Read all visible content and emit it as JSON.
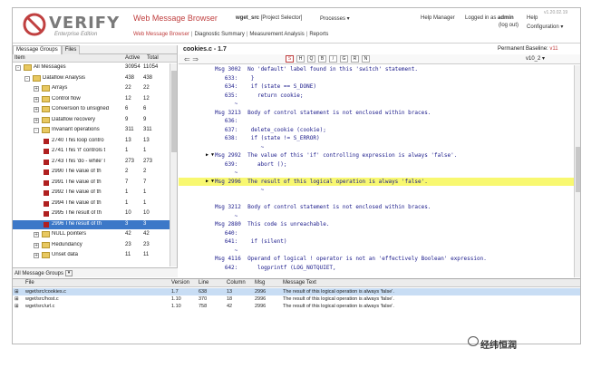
{
  "header": {
    "logo_text": "VERIFY",
    "logo_sub": "Enterprise Edition",
    "app_title": "Web Message Browser",
    "project": "wget_src",
    "project_selector": "[Project Selector]",
    "processes": "Processes ▾",
    "help_manager": "Help Manager",
    "logged_in_as": "Logged in as",
    "user": "admin",
    "logout": "(log out)",
    "help": "Help",
    "configuration": "Configuration ▾",
    "version": "v1.20.02.19",
    "nav_links": [
      "Web Message Browser",
      "Diagnostic Summary",
      "Measurement Analysis",
      "Reports"
    ]
  },
  "left_panel": {
    "tabs": [
      "Message Groups",
      "Files"
    ],
    "columns": [
      "Item",
      "Active",
      "Total"
    ],
    "rows": [
      {
        "label": "All Messages",
        "active": "30954",
        "total": "11054",
        "level": 0,
        "type": "folder",
        "exp": "-"
      },
      {
        "label": "Dataflow Analysis",
        "active": "438",
        "total": "438",
        "level": 1,
        "type": "folder",
        "exp": "-"
      },
      {
        "label": "Arrays",
        "active": "22",
        "total": "22",
        "level": 2,
        "type": "folder",
        "exp": "+"
      },
      {
        "label": "Control flow",
        "active": "12",
        "total": "12",
        "level": 2,
        "type": "folder",
        "exp": "+"
      },
      {
        "label": "Conversion to unsigned",
        "active": "6",
        "total": "6",
        "level": 2,
        "type": "folder",
        "exp": "+"
      },
      {
        "label": "Dataflow recovery",
        "active": "9",
        "total": "9",
        "level": 2,
        "type": "folder",
        "exp": "+"
      },
      {
        "label": "Invariant operations",
        "active": "311",
        "total": "311",
        "level": 2,
        "type": "folder",
        "exp": "-"
      },
      {
        "label": "2740 This loop contro",
        "active": "13",
        "total": "13",
        "level": 3,
        "type": "msg"
      },
      {
        "label": "2741 This 'if' controls t",
        "active": "1",
        "total": "1",
        "level": 3,
        "type": "msg"
      },
      {
        "label": "2743 This 'do - while' l",
        "active": "273",
        "total": "273",
        "level": 3,
        "type": "msg"
      },
      {
        "label": "2990 The value of th",
        "active": "2",
        "total": "2",
        "level": 3,
        "type": "msg"
      },
      {
        "label": "2991 The value of th",
        "active": "7",
        "total": "7",
        "level": 3,
        "type": "msg"
      },
      {
        "label": "2992 The value of th",
        "active": "1",
        "total": "1",
        "level": 3,
        "type": "msg"
      },
      {
        "label": "2994 The value of th",
        "active": "1",
        "total": "1",
        "level": 3,
        "type": "msg"
      },
      {
        "label": "2995 The result of th",
        "active": "10",
        "total": "10",
        "level": 3,
        "type": "msg"
      },
      {
        "label": "2996 The result of th",
        "active": "3",
        "total": "3",
        "level": 3,
        "type": "msg",
        "selected": true
      },
      {
        "label": "NULL pointers",
        "active": "42",
        "total": "42",
        "level": 2,
        "type": "folder",
        "exp": "+"
      },
      {
        "label": "Redundancy",
        "active": "23",
        "total": "23",
        "level": 2,
        "type": "folder",
        "exp": "+"
      },
      {
        "label": "Unset data",
        "active": "11",
        "total": "11",
        "level": 2,
        "type": "folder",
        "exp": "+"
      }
    ],
    "footer_select": "All Message Groups"
  },
  "code_panel": {
    "file_title": "cookies.c - 1.7",
    "baseline_label": "Permanent Baseline:",
    "baseline_value": "v11",
    "version_select": "v10_2 ▾",
    "toolbar": [
      "S",
      "H",
      "Q",
      "B",
      "/",
      "G",
      "R",
      "N"
    ],
    "lines": [
      {
        "mark": "",
        "text": "Msg 3002  No 'default' label found in this 'switch' statement."
      },
      {
        "mark": "",
        "text": "   633:    }"
      },
      {
        "mark": "",
        "text": "   634:    if (state == S_DONE)"
      },
      {
        "mark": "",
        "text": "   635:      return cookie;"
      },
      {
        "mark": "",
        "text": "      ~"
      },
      {
        "mark": "",
        "text": "Msg 3213  Body of control statement is not enclosed within braces."
      },
      {
        "mark": "",
        "text": "   636:"
      },
      {
        "mark": "",
        "text": "   637:    delete_cookie (cookie);"
      },
      {
        "mark": "",
        "text": "   638:    if (state != S_ERROR)"
      },
      {
        "mark": "",
        "text": "              ~"
      },
      {
        "mark": "▶ ▼",
        "text": "Msg 2992  The value of this 'if' controlling expression is always 'false'."
      },
      {
        "mark": "",
        "text": "   639:      abort ();"
      },
      {
        "mark": "",
        "text": "      ~"
      },
      {
        "mark": "▶ ▼",
        "text": "Msg 2996  The result of this logical operation is always 'false'.",
        "highlight": true
      },
      {
        "mark": "",
        "text": "              ~"
      },
      {
        "mark": "",
        "text": ""
      },
      {
        "mark": "",
        "text": "Msg 3212  Body of control statement is not enclosed within braces."
      },
      {
        "mark": "",
        "text": "      ~"
      },
      {
        "mark": "",
        "text": "Msg 2880  This code is unreachable."
      },
      {
        "mark": "",
        "text": "   640:"
      },
      {
        "mark": "",
        "text": "   641:    if (silent)"
      },
      {
        "mark": "",
        "text": "      ~"
      },
      {
        "mark": "",
        "text": "Msg 4116  Operand of logical ! operator is not an 'effectively Boolean' expression."
      },
      {
        "mark": "",
        "text": "   642:      logprintf (LOG_NOTQUIET,"
      }
    ]
  },
  "bottom_panel": {
    "columns": [
      "File",
      "Version",
      "Line",
      "Column",
      "Msg",
      "Message Text"
    ],
    "rows": [
      {
        "file": "wget/src/cookies.c",
        "version": "1.7",
        "line": "638",
        "column": "13",
        "msg": "2996",
        "text": "The result of this logical operation is always 'false'.",
        "selected": true
      },
      {
        "file": "wget/src/host.c",
        "version": "1.10",
        "line": "370",
        "column": "18",
        "msg": "2996",
        "text": "The result of this logical operation is always 'false'."
      },
      {
        "file": "wget/src/url.c",
        "version": "1.10",
        "line": "758",
        "column": "42",
        "msg": "2996",
        "text": "The result of this logical operation is always 'false'."
      }
    ]
  },
  "watermark": "经纬恒润"
}
